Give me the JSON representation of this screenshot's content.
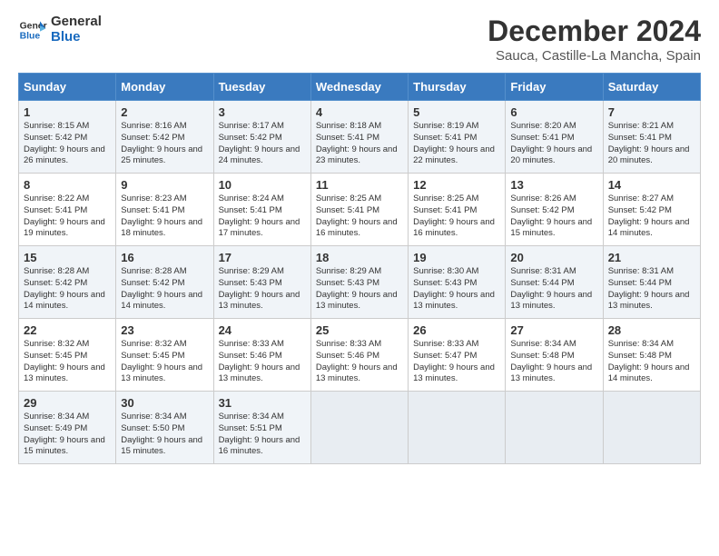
{
  "logo": {
    "line1": "General",
    "line2": "Blue"
  },
  "title": "December 2024",
  "subtitle": "Sauca, Castille-La Mancha, Spain",
  "days_of_week": [
    "Sunday",
    "Monday",
    "Tuesday",
    "Wednesday",
    "Thursday",
    "Friday",
    "Saturday"
  ],
  "weeks": [
    [
      {
        "day": "1",
        "sunrise": "8:15 AM",
        "sunset": "5:42 PM",
        "daylight": "9 hours and 26 minutes."
      },
      {
        "day": "2",
        "sunrise": "8:16 AM",
        "sunset": "5:42 PM",
        "daylight": "9 hours and 25 minutes."
      },
      {
        "day": "3",
        "sunrise": "8:17 AM",
        "sunset": "5:42 PM",
        "daylight": "9 hours and 24 minutes."
      },
      {
        "day": "4",
        "sunrise": "8:18 AM",
        "sunset": "5:41 PM",
        "daylight": "9 hours and 23 minutes."
      },
      {
        "day": "5",
        "sunrise": "8:19 AM",
        "sunset": "5:41 PM",
        "daylight": "9 hours and 22 minutes."
      },
      {
        "day": "6",
        "sunrise": "8:20 AM",
        "sunset": "5:41 PM",
        "daylight": "9 hours and 20 minutes."
      },
      {
        "day": "7",
        "sunrise": "8:21 AM",
        "sunset": "5:41 PM",
        "daylight": "9 hours and 20 minutes."
      }
    ],
    [
      {
        "day": "8",
        "sunrise": "8:22 AM",
        "sunset": "5:41 PM",
        "daylight": "9 hours and 19 minutes."
      },
      {
        "day": "9",
        "sunrise": "8:23 AM",
        "sunset": "5:41 PM",
        "daylight": "9 hours and 18 minutes."
      },
      {
        "day": "10",
        "sunrise": "8:24 AM",
        "sunset": "5:41 PM",
        "daylight": "9 hours and 17 minutes."
      },
      {
        "day": "11",
        "sunrise": "8:25 AM",
        "sunset": "5:41 PM",
        "daylight": "9 hours and 16 minutes."
      },
      {
        "day": "12",
        "sunrise": "8:25 AM",
        "sunset": "5:41 PM",
        "daylight": "9 hours and 16 minutes."
      },
      {
        "day": "13",
        "sunrise": "8:26 AM",
        "sunset": "5:42 PM",
        "daylight": "9 hours and 15 minutes."
      },
      {
        "day": "14",
        "sunrise": "8:27 AM",
        "sunset": "5:42 PM",
        "daylight": "9 hours and 14 minutes."
      }
    ],
    [
      {
        "day": "15",
        "sunrise": "8:28 AM",
        "sunset": "5:42 PM",
        "daylight": "9 hours and 14 minutes."
      },
      {
        "day": "16",
        "sunrise": "8:28 AM",
        "sunset": "5:42 PM",
        "daylight": "9 hours and 14 minutes."
      },
      {
        "day": "17",
        "sunrise": "8:29 AM",
        "sunset": "5:43 PM",
        "daylight": "9 hours and 13 minutes."
      },
      {
        "day": "18",
        "sunrise": "8:29 AM",
        "sunset": "5:43 PM",
        "daylight": "9 hours and 13 minutes."
      },
      {
        "day": "19",
        "sunrise": "8:30 AM",
        "sunset": "5:43 PM",
        "daylight": "9 hours and 13 minutes."
      },
      {
        "day": "20",
        "sunrise": "8:31 AM",
        "sunset": "5:44 PM",
        "daylight": "9 hours and 13 minutes."
      },
      {
        "day": "21",
        "sunrise": "8:31 AM",
        "sunset": "5:44 PM",
        "daylight": "9 hours and 13 minutes."
      }
    ],
    [
      {
        "day": "22",
        "sunrise": "8:32 AM",
        "sunset": "5:45 PM",
        "daylight": "9 hours and 13 minutes."
      },
      {
        "day": "23",
        "sunrise": "8:32 AM",
        "sunset": "5:45 PM",
        "daylight": "9 hours and 13 minutes."
      },
      {
        "day": "24",
        "sunrise": "8:33 AM",
        "sunset": "5:46 PM",
        "daylight": "9 hours and 13 minutes."
      },
      {
        "day": "25",
        "sunrise": "8:33 AM",
        "sunset": "5:46 PM",
        "daylight": "9 hours and 13 minutes."
      },
      {
        "day": "26",
        "sunrise": "8:33 AM",
        "sunset": "5:47 PM",
        "daylight": "9 hours and 13 minutes."
      },
      {
        "day": "27",
        "sunrise": "8:34 AM",
        "sunset": "5:48 PM",
        "daylight": "9 hours and 13 minutes."
      },
      {
        "day": "28",
        "sunrise": "8:34 AM",
        "sunset": "5:48 PM",
        "daylight": "9 hours and 14 minutes."
      }
    ],
    [
      {
        "day": "29",
        "sunrise": "8:34 AM",
        "sunset": "5:49 PM",
        "daylight": "9 hours and 15 minutes."
      },
      {
        "day": "30",
        "sunrise": "8:34 AM",
        "sunset": "5:50 PM",
        "daylight": "9 hours and 15 minutes."
      },
      {
        "day": "31",
        "sunrise": "8:34 AM",
        "sunset": "5:51 PM",
        "daylight": "9 hours and 16 minutes."
      },
      null,
      null,
      null,
      null
    ]
  ],
  "labels": {
    "sunrise": "Sunrise:",
    "sunset": "Sunset:",
    "daylight": "Daylight:"
  }
}
